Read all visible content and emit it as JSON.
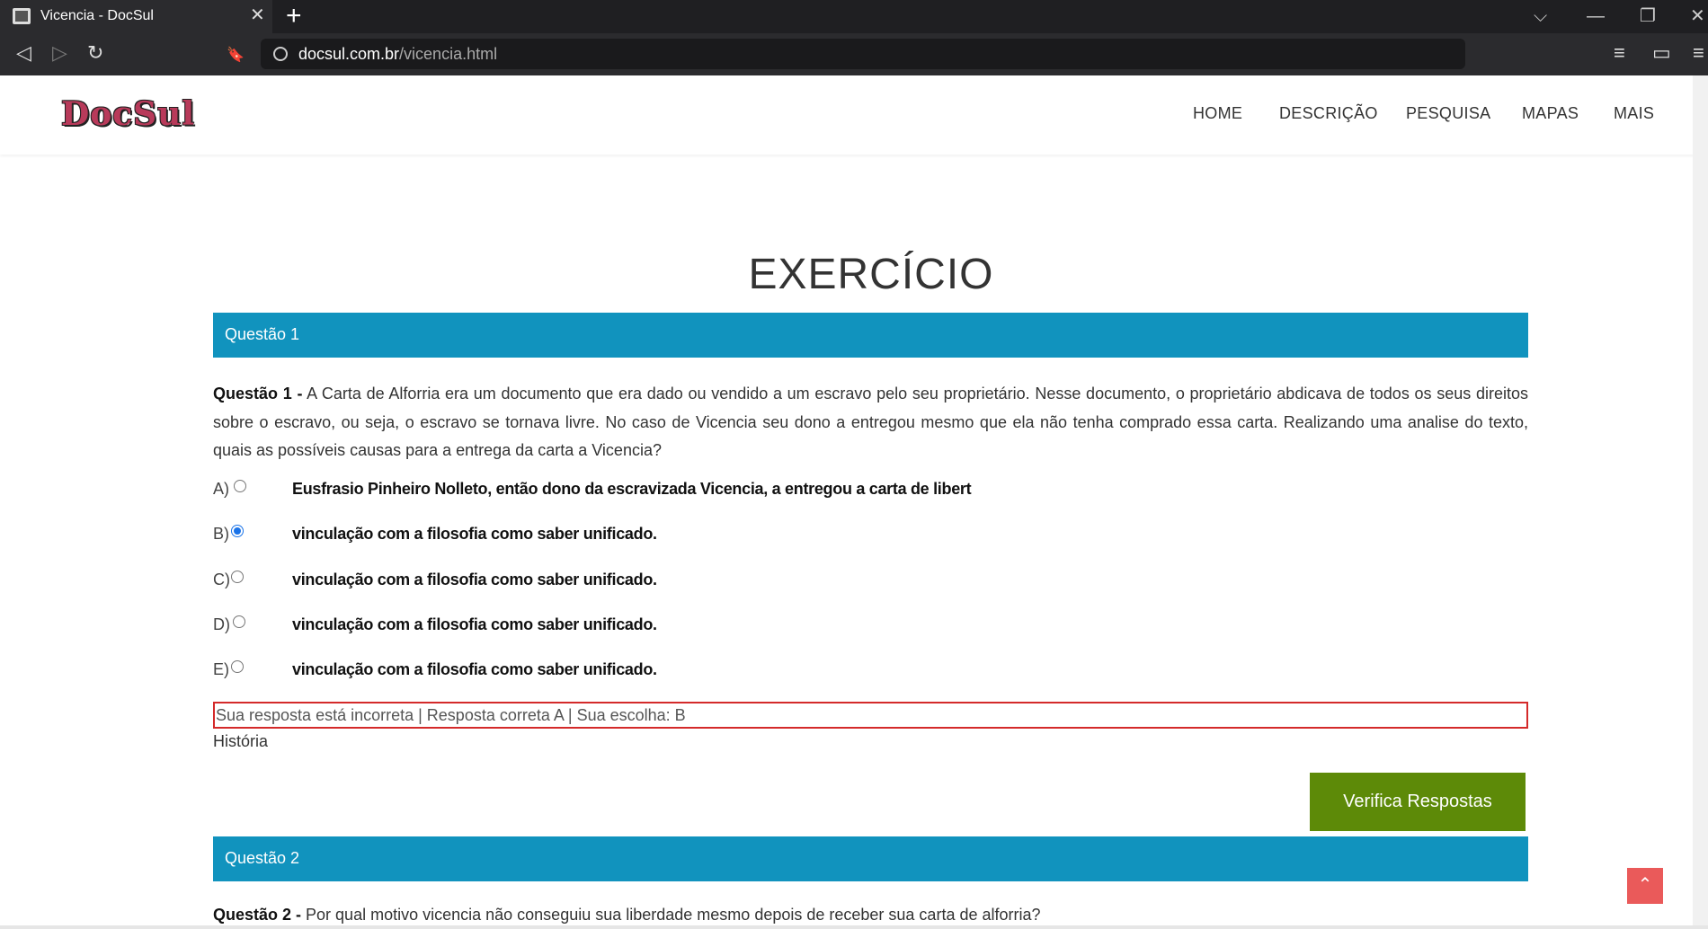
{
  "browser": {
    "tab_title": "Vicencia - DocSul",
    "tab_close": "✕",
    "new_tab": "+",
    "url_domain": "docsul.com.br",
    "url_path": "/vicencia.html",
    "controls": {
      "tabs_list": "⌵",
      "minimize": "—",
      "restore": "❐",
      "close": "✕"
    },
    "nav": {
      "back": "◁",
      "forward": "▷",
      "reload": "↻",
      "bookmark": "🔖",
      "playlist": "≡",
      "wallet": "▭",
      "menu": "≡"
    }
  },
  "site": {
    "logo": "DocSul",
    "menu": [
      "HOME",
      "DESCRIÇÃO",
      "PESQUISA",
      "MAPAS",
      "MAIS"
    ]
  },
  "main": {
    "title": "EXERCÍCIO",
    "question1": {
      "header": "Questão 1",
      "label": "Questão 1 -",
      "text": " A Carta de Alforria era um documento que era dado ou vendido a um escravo pelo seu proprietário. Nesse documento, o proprietário abdicava de todos os seus direitos sobre o escravo, ou seja, o escravo se tornava livre. No caso de Vicencia seu dono a entregou mesmo que ela não tenha comprado essa carta. Realizando uma analise do texto, quais as possíveis causas para a entrega da carta a Vicencia?",
      "options": [
        {
          "letter": "A)",
          "text": "Eusfrasio Pinheiro Nolleto, então dono da escravizada Vicencia, a entregou a carta de libert",
          "selected": false
        },
        {
          "letter": "B)",
          "text": "vinculação com a filosofia como saber unificado.",
          "selected": true
        },
        {
          "letter": "C)",
          "text": "vinculação com a filosofia como saber unificado.",
          "selected": false
        },
        {
          "letter": "D)",
          "text": "vinculação com a filosofia como saber unificado.",
          "selected": false
        },
        {
          "letter": "E)",
          "text": "vinculação com a filosofia como saber unificado.",
          "selected": false
        }
      ],
      "result": "Sua resposta está incorreta | Resposta correta A | Sua escolha: B",
      "subject": "História"
    },
    "verify_button": "Verifica Respostas",
    "question2": {
      "header": "Questão 2",
      "label": "Questão 2 -",
      "text": " Por qual motivo vicencia não conseguiu sua liberdade mesmo depois de receber sua carta de alforria?"
    },
    "to_top": "⌃"
  },
  "colors": {
    "question_header": "#1193be",
    "verify_button": "#5d8a08",
    "result_border": "#d42a2a",
    "to_top": "#ea5a5a"
  }
}
